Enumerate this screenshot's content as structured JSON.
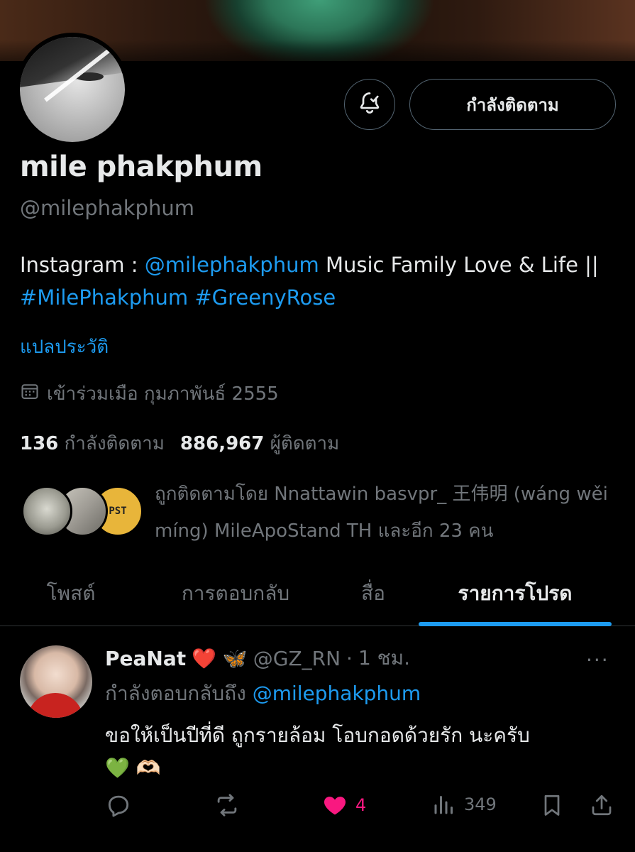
{
  "profile": {
    "name": "mile phakphum",
    "handle": "@milephakphum",
    "follow_label": "กำลังติดตาม",
    "bio": {
      "prefix": "Instagram : ",
      "ig_link": "@milephakphum",
      "middle": " Music Family Love & Life || ",
      "tag1": "#MilePhakphum",
      "space": " ",
      "tag2": "#GreenyRose"
    },
    "translate_label": "แปลประวัติ",
    "joined": "เข้าร่วมเมือ กุมภาพันธ์ 2555",
    "following_count": "136",
    "following_label": "กำลังติดตาม",
    "followers_count": "886,967",
    "followers_label": "ผู้ติดตาม",
    "followed_by": "ถูกติดตามโดย Nnattawin basvpr_ 王伟明 (wáng wěi míng) MileApoStand TH และอีก 23 คน",
    "followed_by_avatar3_text": "PST"
  },
  "tabs": [
    {
      "label": "โพสต์",
      "active": false
    },
    {
      "label": "การตอบกลับ",
      "active": false
    },
    {
      "label": "สื่อ",
      "active": false
    },
    {
      "label": "รายการโปรด",
      "active": true
    }
  ],
  "post": {
    "name": "PeaNat",
    "emoji": "❤️ 🦋",
    "handle": "@GZ_RN",
    "separator": "·",
    "time": "1 ชม.",
    "replying_prefix": "กำลังตอบกลับถึง ",
    "replying_to": "@milephakphum",
    "text_line1": "ขอให้เป็นปีที่ดี ถูกรายล้อม โอบกอดด้วยรัก นะครับ",
    "text_line2": "💚 🫶🏻",
    "more": "···",
    "likes": "4",
    "views": "349"
  },
  "colors": {
    "accent": "#1d9bf0",
    "like": "#f91880",
    "muted": "#71767b",
    "text": "#e7e9ea",
    "border": "#2f3336"
  },
  "icons": [
    "bell-check-icon",
    "calendar-icon",
    "reply-icon",
    "repost-icon",
    "heart-icon",
    "views-icon",
    "bookmark-icon",
    "share-icon",
    "more-icon"
  ]
}
